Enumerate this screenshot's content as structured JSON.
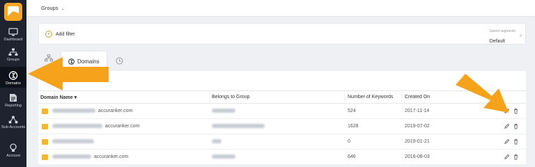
{
  "header": {
    "group_label": "Groups"
  },
  "filter": {
    "add_label": "Add filter",
    "segments_caption": "Saved segments",
    "segments_value": "Default"
  },
  "sidebar": {
    "items": [
      {
        "label": "Dashboard",
        "icon": "monitor-icon"
      },
      {
        "label": "Groups",
        "icon": "sitemap-icon"
      },
      {
        "label": "Domains",
        "icon": "domain-icon",
        "active": true
      },
      {
        "label": "Reporting",
        "icon": "report-icon"
      },
      {
        "label": "Sub-Accounts",
        "icon": "share-nodes-icon"
      },
      {
        "label": "Account",
        "icon": "lightbulb-icon"
      }
    ]
  },
  "tabs": {
    "active_label": "Domains"
  },
  "table": {
    "columns": [
      "Domain Name",
      "Belongs to Group",
      "Number of Keywords",
      "Created On"
    ],
    "rows": [
      {
        "domain": "accuranker.com",
        "keywords": "524",
        "created": "2017-11-14"
      },
      {
        "domain": "accuranker.com",
        "keywords": "1628",
        "created": "2019-07-02"
      },
      {
        "domain": "",
        "keywords": "0",
        "created": "2019-01-21"
      },
      {
        "domain": "accuranker.com",
        "keywords": "646",
        "created": "2016-08-03"
      }
    ]
  },
  "colors": {
    "sidebar": "#1f2330",
    "accent": "#f5a623",
    "arrow": "#f7a21b"
  }
}
